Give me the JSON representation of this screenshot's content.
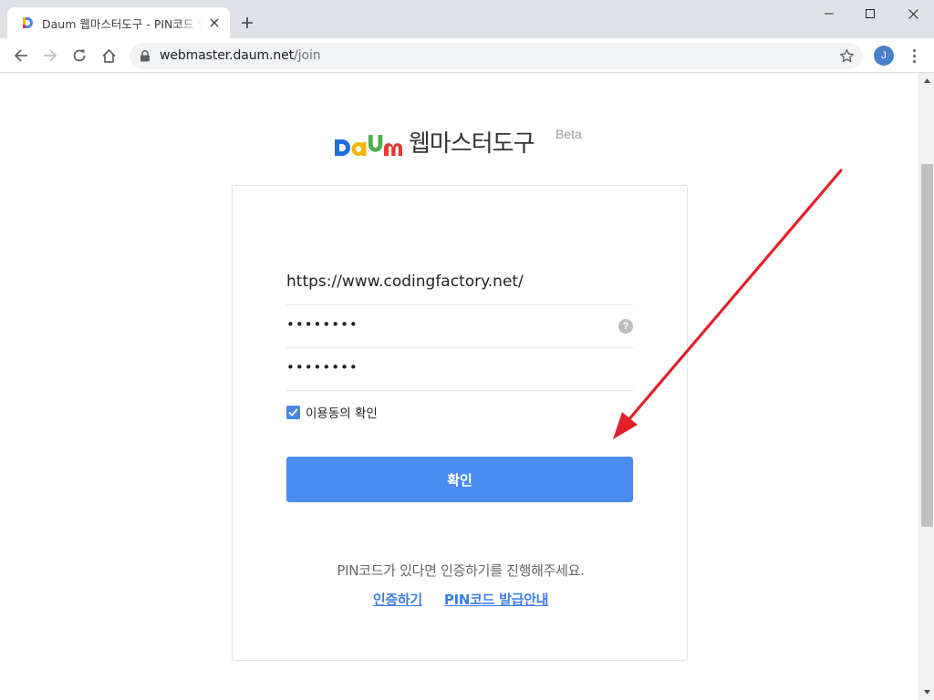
{
  "browser": {
    "tab_title": "Daum 웹마스터도구 - PIN코드 발급",
    "url_host": "webmaster.daum.net",
    "url_path": "/join",
    "profile_initial": "J"
  },
  "brand": {
    "logo_text": "Daum",
    "title": "웹마스터도구",
    "badge": "Beta",
    "logo_colors": [
      "#1f6fdc",
      "#f4b400",
      "#4caf50",
      "#e53935"
    ]
  },
  "form": {
    "site_url_value": "https://www.codingfactory.net/",
    "password_value": "abcd1234",
    "password_confirm_value": "abcd1234",
    "help_symbol": "?",
    "agree_label": "이용동의 확인",
    "submit_label": "확인"
  },
  "footer": {
    "pin_message": "PIN코드가 있다면 인증하기를 진행해주세요.",
    "verify_link": "인증하기",
    "pin_guide_link": "PIN코드 발급안내"
  },
  "colors": {
    "accent": "#4a8df0",
    "link": "#3b7ee8",
    "annotation_arrow": "#e3202a"
  }
}
